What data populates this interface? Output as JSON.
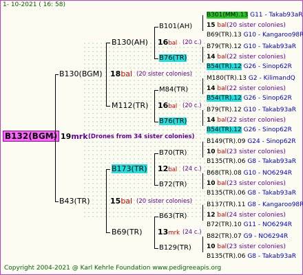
{
  "header": {
    "date": "1- 10-2021 ( 16: 58)"
  },
  "footer": {
    "copyright": "Copyright 2004-2021 @ Karl Kehrle Foundation   www.pedigreeapis.org"
  },
  "root": {
    "label": "B132(BGM)",
    "num": "19",
    "unit": "mrk",
    "note": "(Drones from 34 sister colonies)"
  },
  "gen1": [
    {
      "label": "B130(BGM)",
      "num": "18",
      "unit": "bal",
      "note": "(20 sister colonies)"
    },
    {
      "label": "B43(TR)",
      "num": "15",
      "unit": "bal",
      "note": "(20 sister colonies)"
    }
  ],
  "gen2": [
    {
      "label": "B130(AH)",
      "num": "16",
      "unit": "bal",
      "note": "(20 c.)"
    },
    {
      "label": "M112(TR)",
      "num": "16",
      "unit": "bal",
      "note": "(20 c.)"
    },
    {
      "label": "B173(TR)",
      "num": "12",
      "unit": "bal",
      "note": "(24 c.)"
    },
    {
      "label": "B69(TR)",
      "num": "13",
      "unit": "mrk",
      "note": "(24 c.)"
    }
  ],
  "gen3": [
    {
      "label": "B101(AH)",
      "num": "15",
      "unit": "bal",
      "note": "(20 sister colonies)"
    },
    {
      "label": "B76(TR)",
      "num": "14",
      "unit": "bal",
      "note": "(22 sister colonies)"
    },
    {
      "label": "M84(TR)",
      "num": "14",
      "unit": "bal",
      "note": "(22 sister colonies)"
    },
    {
      "label": "B76(TR)",
      "num": "14",
      "unit": "bal",
      "note": "(22 sister colonies)"
    },
    {
      "label": "B70(TR)",
      "num": "10",
      "unit": "bal",
      "note": "(23 sister colonies)"
    },
    {
      "label": "B72(TR)",
      "num": "10",
      "unit": "bal",
      "note": "(23 sister colonies)"
    },
    {
      "label": "B63(TR)",
      "num": "12",
      "unit": "bal",
      "note": "(24 sister colonies)"
    },
    {
      "label": "B129(TR)",
      "num": "10",
      "unit": "bal",
      "note": "(23 sister colonies)"
    }
  ],
  "gen4": [
    {
      "label": "B301(MM).13",
      "breeder": "G11 - Takab93aR"
    },
    {
      "label": "B69(TR).13",
      "breeder": "G10 - Kangaroo98R"
    },
    {
      "label": "B79(TR).12",
      "breeder": "G10 - Takab93aR"
    },
    {
      "label": "B54(TR).12",
      "breeder": "G26 - Sinop62R"
    },
    {
      "label": "M180(TR).13",
      "breeder": "G2 - KilimandQ"
    },
    {
      "label": "B54(TR).12",
      "breeder": "G26 - Sinop62R"
    },
    {
      "label": "B79(TR).12",
      "breeder": "G10 - Takab93aR"
    },
    {
      "label": "B54(TR).12",
      "breeder": "G26 - Sinop62R"
    },
    {
      "label": "B149(TR).09",
      "breeder": "G24 - Sinop62R"
    },
    {
      "label": "B135(TR).06",
      "breeder": "G8 - Takab93aR"
    },
    {
      "label": "B68(TR).08",
      "breeder": "G10 - NO6294R"
    },
    {
      "label": "B135(TR).06",
      "breeder": "G8 - Takab93aR"
    },
    {
      "label": "B137(TR).11",
      "breeder": "G8 - Kangaroo98R"
    },
    {
      "label": "B72(TR).10",
      "breeder": "G11 - NO6294R"
    },
    {
      "label": "B82(TR).07",
      "breeder": "G9 - NO6294R"
    },
    {
      "label": "B135(TR).06",
      "breeder": "G8 - Takab93aR"
    }
  ]
}
